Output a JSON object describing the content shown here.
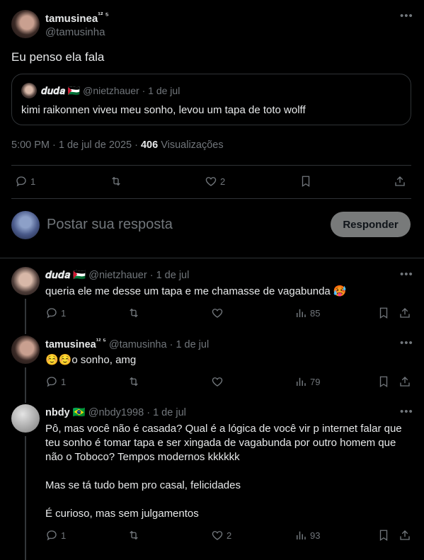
{
  "main_post": {
    "display_name": "tamusinea",
    "name_suffix": "¹² ⁵",
    "handle": "@tamusinha",
    "text": "Eu penso ela fala",
    "quote": {
      "display_name": "𝒅𝒖𝒅𝒂",
      "flag": "🇵🇸",
      "handle": "@nietzhauer",
      "date": "1 de jul",
      "text": "kimi raikonnen viveu meu sonho, levou um tapa de toto wolff"
    },
    "timestamp": "5:00 PM · 1 de jul de 2025 · ",
    "views_count": "406",
    "views_label": " Visualizações",
    "stats": {
      "replies": "1",
      "retweets": "",
      "likes": "2"
    }
  },
  "reply_box": {
    "placeholder": "Postar sua resposta",
    "button_label": "Responder"
  },
  "replies": [
    {
      "display_name": "𝒅𝒖𝒅𝒂",
      "flag": "🇵🇸",
      "handle": "@nietzhauer",
      "date": "1 de jul",
      "text": "queria ele me desse um tapa e me chamasse de vagabunda 🥵",
      "replies": "1",
      "likes": "",
      "views": "85"
    },
    {
      "display_name": "tamusinea",
      "name_suffix": "¹² ⁵",
      "handle": "@tamusinha",
      "date": "1 de jul",
      "text": "☺️☺️o sonho, amg",
      "replies": "1",
      "likes": "",
      "views": "79"
    },
    {
      "display_name": "nbdy",
      "flag": "🇧🇷",
      "handle": "@nbdy1998",
      "date": "1 de jul",
      "text_lines": [
        "Pô, mas você não é casada? Qual é a lógica de você vir p internet falar que",
        "teu sonho é tomar tapa e ser xingada de vagabunda por outro homem que",
        "não o Toboco? Tempos modernos kkkkkk",
        "",
        "Mas se tá tudo bem pro casal, felicidades",
        "",
        "É curioso, mas sem julgamentos"
      ],
      "replies": "1",
      "likes": "2",
      "views": "93"
    }
  ],
  "colors": {
    "background": "#000000",
    "text": "#e7e9ea",
    "muted": "#71767b",
    "border": "#2f3336",
    "button_bg": "#787a7a"
  }
}
